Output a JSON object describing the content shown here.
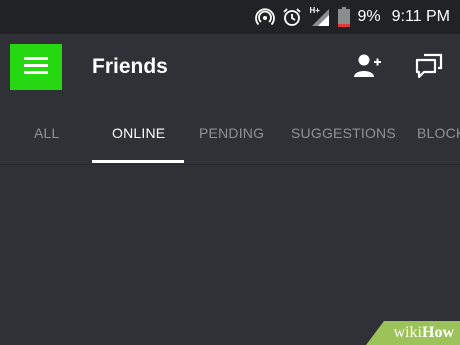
{
  "status_bar": {
    "battery_percent_text": "9%",
    "time": "9:11 PM",
    "network_label": "H+",
    "icons": [
      "hotspot-icon",
      "alarm-icon",
      "signal-icon",
      "battery-icon"
    ]
  },
  "header": {
    "title": "Friends",
    "icons": [
      "hamburger-menu-icon",
      "add-friend-icon",
      "new-message-icon"
    ],
    "highlight_color": "#25d812"
  },
  "tabs": [
    {
      "label": "ALL",
      "active": false
    },
    {
      "label": "ONLINE",
      "active": true
    },
    {
      "label": "PENDING",
      "active": false
    },
    {
      "label": "SUGGESTIONS",
      "active": false
    },
    {
      "label": "BLOCKED",
      "active": false
    }
  ],
  "colors": {
    "background": "#2f3136",
    "status_bar": "#202225",
    "active_tab": "#ffffff",
    "inactive_tab": "#8e9297"
  },
  "watermark": {
    "wiki": "wiki",
    "how": "How"
  }
}
